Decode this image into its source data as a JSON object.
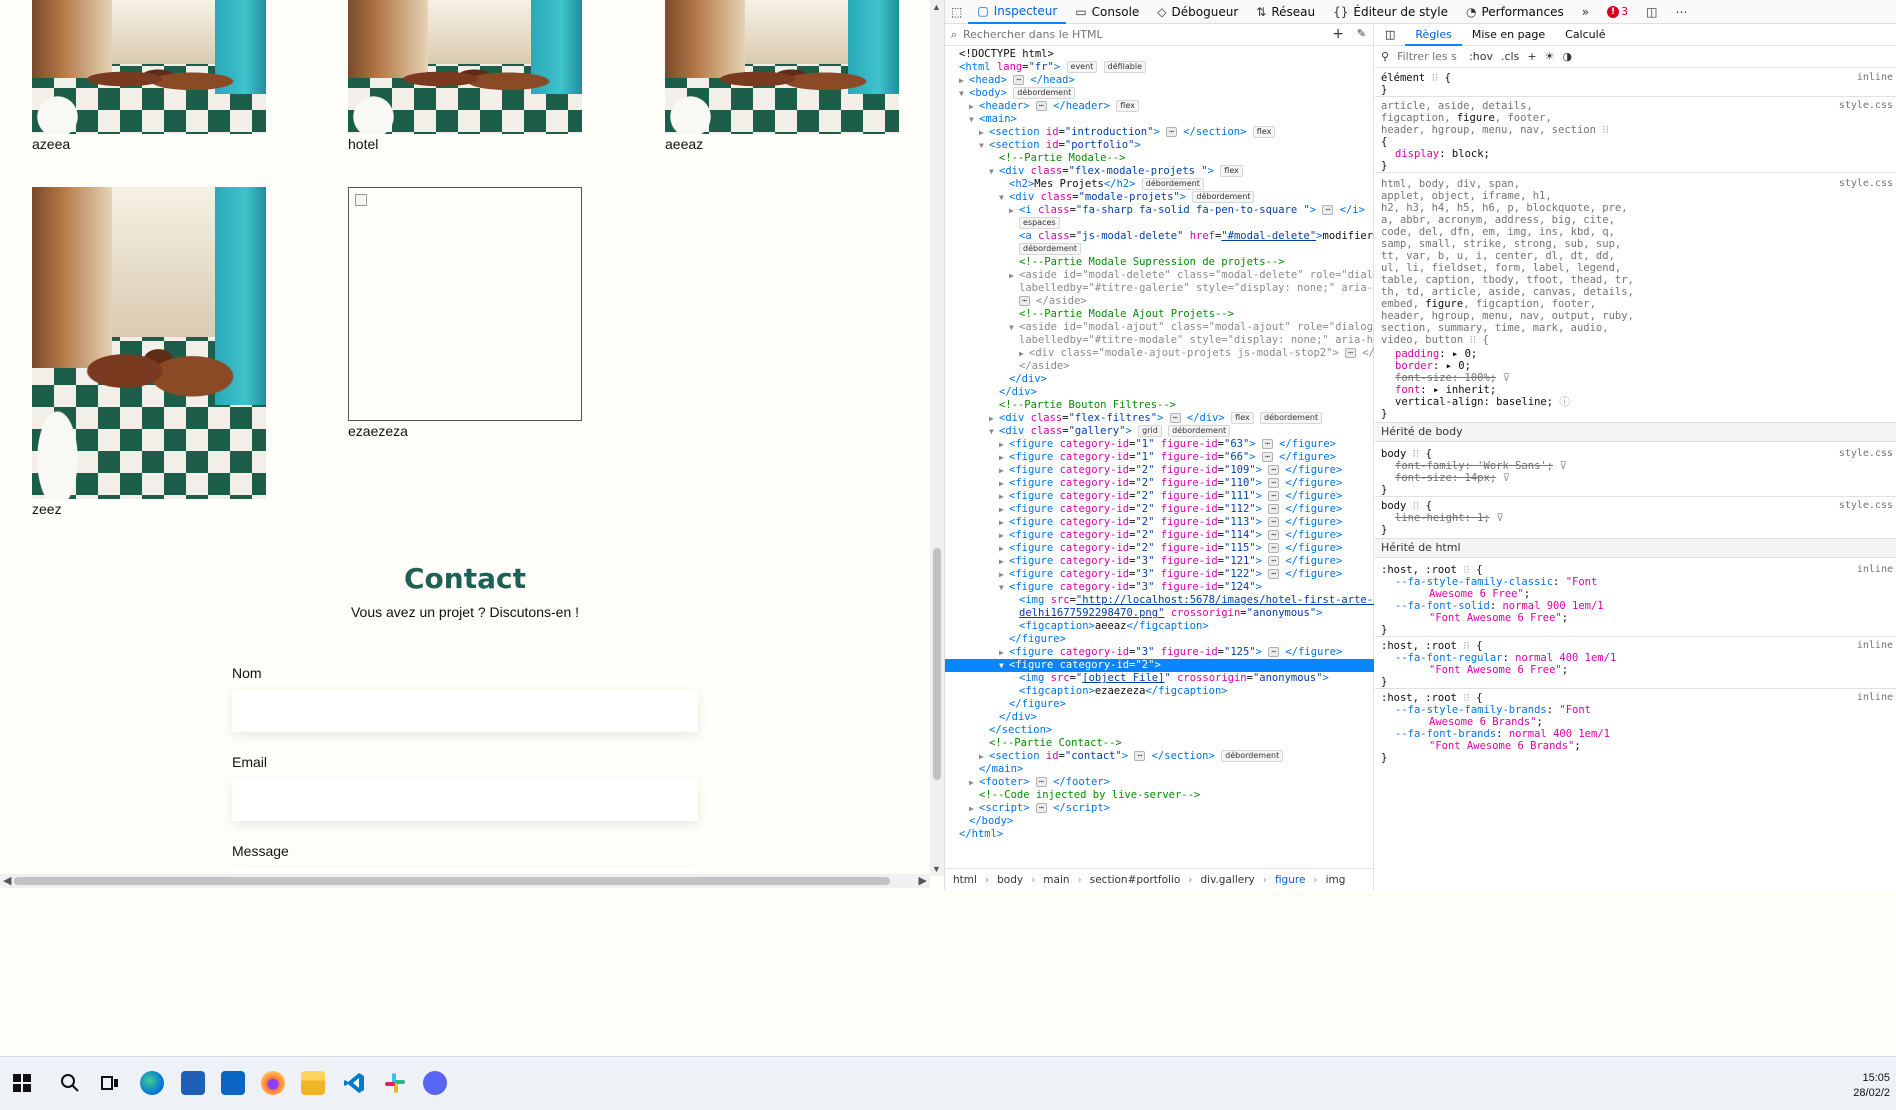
{
  "page": {
    "gallery": [
      {
        "caption": "azeea"
      },
      {
        "caption": "hotel"
      },
      {
        "caption": "aeeaz"
      },
      {
        "caption": "zeez"
      },
      {
        "caption": "ezaezeza"
      }
    ],
    "contact": {
      "title": "Contact",
      "subtitle": "Vous avez un projet ? Discutons-en !",
      "name_label": "Nom",
      "email_label": "Email",
      "message_label": "Message"
    }
  },
  "devtools": {
    "tabs": [
      {
        "label": "Inspecteur",
        "icon": "inspector-icon",
        "active": true
      },
      {
        "label": "Console",
        "icon": "console-icon"
      },
      {
        "label": "Débogueur",
        "icon": "debugger-icon"
      },
      {
        "label": "Réseau",
        "icon": "network-icon"
      },
      {
        "label": "Éditeur de style",
        "icon": "style-editor-icon"
      },
      {
        "label": "Performances",
        "icon": "performance-icon"
      }
    ],
    "error_count": "3",
    "search_placeholder": "Rechercher dans le HTML",
    "breadcrumbs": [
      "html",
      "body",
      "main",
      "section#portfolio",
      "div.gallery",
      "figure",
      "img"
    ],
    "rules_tabs": [
      "Règles",
      "Mise en page",
      "Calculé"
    ],
    "filter_placeholder": "Filtrer les s",
    "hov": ":hov",
    "cls": ".cls",
    "inherited_body": "Hérité de body",
    "inherited_html": "Hérité de html",
    "style_source": "style.css",
    "inline_source": "inline"
  },
  "taskbar": {
    "time": "15:05",
    "date": "28/02/2"
  },
  "colors": {
    "accent": "#1d6154",
    "devtools_blue": "#0a84ff",
    "selected_bg": "#0a84ff",
    "page_bg": "#fffef8"
  }
}
